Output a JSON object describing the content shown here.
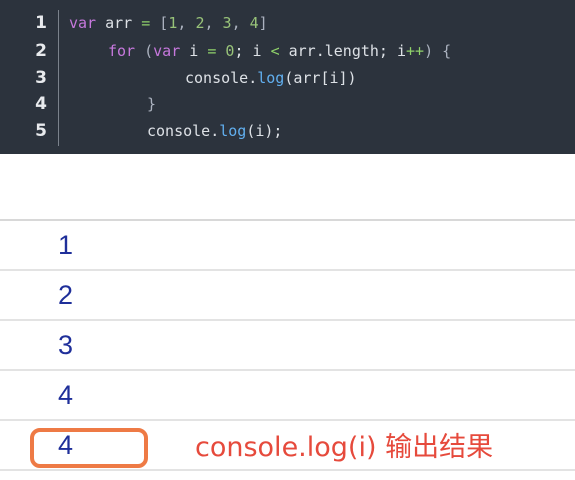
{
  "editor": {
    "lines": [
      {
        "number": "1",
        "tokens": [
          {
            "text": "var",
            "kind": "kw"
          },
          {
            "text": " arr ",
            "kind": "var"
          },
          {
            "text": "=",
            "kind": "op"
          },
          {
            "text": " [",
            "kind": "pun"
          },
          {
            "text": "1",
            "kind": "num"
          },
          {
            "text": ", ",
            "kind": "pun"
          },
          {
            "text": "2",
            "kind": "num"
          },
          {
            "text": ", ",
            "kind": "pun"
          },
          {
            "text": "3",
            "kind": "num"
          },
          {
            "text": ", ",
            "kind": "pun"
          },
          {
            "text": "4",
            "kind": "num"
          },
          {
            "text": "]",
            "kind": "pun"
          }
        ]
      },
      {
        "number": "2",
        "tokens": [
          {
            "text": "for",
            "kind": "kw"
          },
          {
            "text": " (",
            "kind": "pun"
          },
          {
            "text": "var",
            "kind": "kw"
          },
          {
            "text": " i ",
            "kind": "var"
          },
          {
            "text": "=",
            "kind": "op"
          },
          {
            "text": " ",
            "kind": "var"
          },
          {
            "text": "0",
            "kind": "num"
          },
          {
            "text": "; i ",
            "kind": "var"
          },
          {
            "text": "<",
            "kind": "op"
          },
          {
            "text": " arr.length; i",
            "kind": "var"
          },
          {
            "text": "++",
            "kind": "op"
          },
          {
            "text": ") {",
            "kind": "pun"
          }
        ]
      },
      {
        "number": "3",
        "tokens": [
          {
            "text": "console.",
            "kind": "var"
          },
          {
            "text": "log",
            "kind": "fn"
          },
          {
            "text": "(arr[i])",
            "kind": "var"
          }
        ]
      },
      {
        "number": "4",
        "tokens": [
          {
            "text": "}",
            "kind": "pun"
          }
        ]
      },
      {
        "number": "5",
        "tokens": [
          {
            "text": "console.",
            "kind": "var"
          },
          {
            "text": "log",
            "kind": "fn"
          },
          {
            "text": "(i);",
            "kind": "var"
          }
        ]
      }
    ]
  },
  "console": {
    "outputs": [
      "1",
      "2",
      "3",
      "4",
      "4"
    ],
    "annotation": "console.log(i) 输出结果"
  },
  "colors": {
    "editor_bg": "#2c333d",
    "keyword": "#c678dd",
    "number": "#98c379",
    "function": "#61afef",
    "output_text": "#1f2f9a",
    "highlight": "#ee7a45",
    "annotation": "#e64a3c"
  }
}
